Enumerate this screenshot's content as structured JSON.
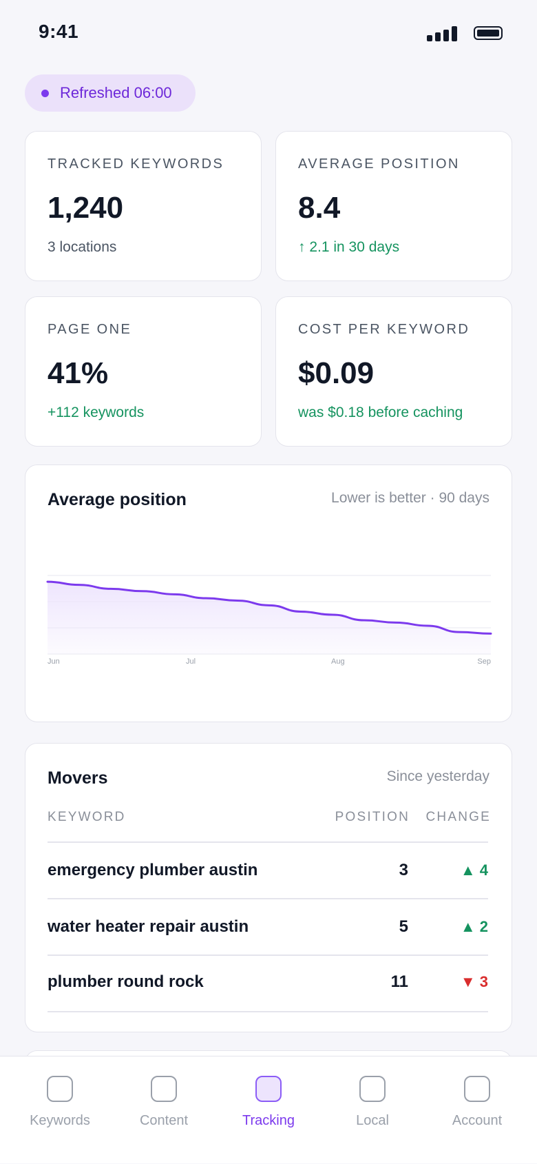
{
  "status_bar": {
    "time": "9:41"
  },
  "refresh": {
    "label": "Refreshed 06:00"
  },
  "stats": [
    {
      "label": "TRACKED KEYWORDS",
      "value": "1,240",
      "sub": "3 locations"
    },
    {
      "label": "AVERAGE POSITION",
      "value": "8.4",
      "sub": "↑ 2.1 in 30 days"
    },
    {
      "label": "PAGE ONE",
      "value": "41%",
      "sub": "+112 keywords"
    },
    {
      "label": "COST PER KEYWORD",
      "value": "$0.09",
      "sub": "was $0.18 before caching"
    }
  ],
  "chart_card": {
    "title": "Average position",
    "hint": "Lower is better · 90 days"
  },
  "chart_data": {
    "type": "area",
    "title": "Average position",
    "x_ticks": [
      "Jun",
      "Jul",
      "Aug",
      "Sep"
    ],
    "x": [
      "Jun 1",
      "Jun 8",
      "Jun 15",
      "Jun 22",
      "Jun 29",
      "Jul 6",
      "Jul 13",
      "Jul 20",
      "Jul 27",
      "Aug 3",
      "Aug 10",
      "Aug 17",
      "Aug 24",
      "Aug 31",
      "Sep 7"
    ],
    "series": [
      {
        "values": [
          12.2,
          11.8,
          11.3,
          11.0,
          10.6,
          10.1,
          9.8,
          9.2,
          8.4,
          8.0,
          7.3,
          7.0,
          6.6,
          5.8,
          5.6
        ]
      }
    ],
    "ylim": [
      3,
      13
    ],
    "reversed_y": true,
    "grid": true,
    "line_color": "#7c3aed",
    "fill_color": "#ede4fd"
  },
  "movers": {
    "title": "Movers",
    "hint": "Since yesterday",
    "columns": {
      "keyword": "KEYWORD",
      "position": "POSITION",
      "change": "CHANGE"
    },
    "rows": [
      {
        "keyword": "emergency plumber austin",
        "position": "3",
        "change": "▲ 4",
        "direction": "up"
      },
      {
        "keyword": "water heater repair austin",
        "position": "5",
        "change": "▲ 2",
        "direction": "up"
      },
      {
        "keyword": "plumber round rock",
        "position": "11",
        "change": "▼ 3",
        "direction": "down"
      }
    ]
  },
  "tabs": [
    {
      "label": "Keywords",
      "active": false
    },
    {
      "label": "Content",
      "active": false
    },
    {
      "label": "Tracking",
      "active": true
    },
    {
      "label": "Local",
      "active": false
    },
    {
      "label": "Account",
      "active": false
    }
  ],
  "colors": {
    "accent": "#7c3aed",
    "positive": "#15935f",
    "negative": "#d92d2d"
  }
}
